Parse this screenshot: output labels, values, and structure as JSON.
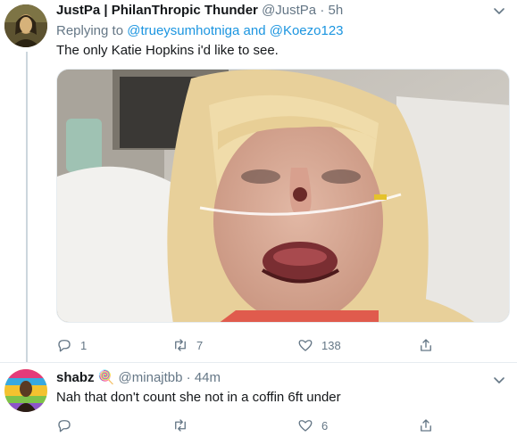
{
  "tweet1": {
    "name": "JustPa | PhilanThropic Thunder",
    "handle": "@JustPa",
    "separator": "·",
    "time": "5h",
    "replying_prefix": "Replying to",
    "replying_user1": "@trueysumhotniga",
    "replying_and": "and",
    "replying_user2": "@Koezo123",
    "text": "The only Katie Hopkins i'd like to see.",
    "reply_count": "1",
    "retweet_count": "7",
    "like_count": "138",
    "icons": [
      "chevron-down-icon",
      "reply-icon",
      "retweet-icon",
      "like-icon",
      "share-icon"
    ]
  },
  "tweet2": {
    "name": "shabz",
    "emoji": "🍭",
    "handle": "@minajtbb",
    "separator": "·",
    "time": "44m",
    "text": "Nah that don't count she not in a coffin 6ft under",
    "reply_count": "",
    "retweet_count": "",
    "like_count": "6",
    "icons": [
      "chevron-down-icon",
      "reply-icon",
      "retweet-icon",
      "like-icon",
      "share-icon"
    ]
  },
  "colors": {
    "link": "#1b95e0",
    "secondary_text": "#657786",
    "primary_text": "#14171a",
    "thread_line": "#ccd6dd"
  }
}
